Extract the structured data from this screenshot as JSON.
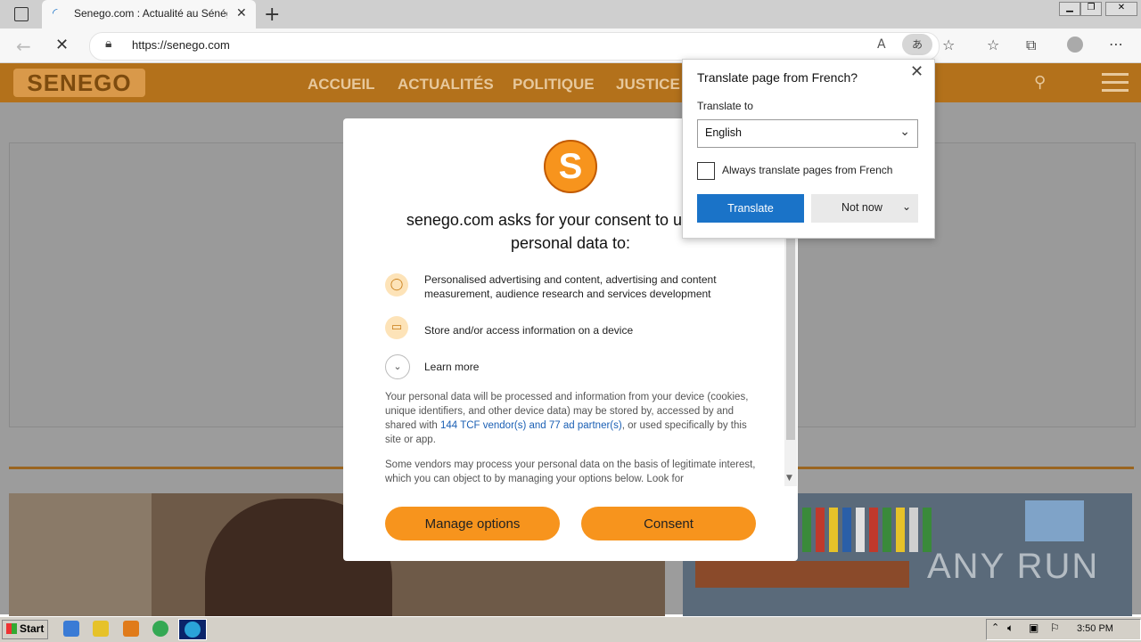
{
  "browser": {
    "tab_title": "Senego.com : Actualité au Sénégal",
    "url": "https://senego.com",
    "new_tab_label": "+"
  },
  "site": {
    "logo_text": "SENEGO",
    "nav": [
      "ACCUEIL",
      "ACTUALITÉS",
      "POLITIQUE",
      "JUSTICE"
    ]
  },
  "consent": {
    "logo_letter": "S",
    "title": "senego.com asks for your consent to use your personal data to:",
    "purposes": [
      {
        "icon": "person-icon",
        "text": "Personalised advertising and content, advertising and content measurement, audience research and services development"
      },
      {
        "icon": "device-icon",
        "text": "Store and/or access information on a device"
      }
    ],
    "learn_more": "Learn more",
    "para1_a": "Your personal data will be processed and information from your device (cookies, unique identifiers, and other device data) may be stored by, accessed by and shared with ",
    "para1_link": "144 TCF vendor(s) and 77 ad partner(s)",
    "para1_b": ", or used specifically by this site or app.",
    "para2": "Some vendors may process your personal data on the basis of legitimate interest, which you can object to by managing your options below. Look for",
    "manage_label": "Manage options",
    "consent_label": "Consent"
  },
  "translate": {
    "title": "Translate page from French?",
    "translate_to_label": "Translate to",
    "language": "English",
    "always_label": "Always translate pages from French",
    "translate_btn": "Translate",
    "not_now_btn": "Not now"
  },
  "taskbar": {
    "start": "Start",
    "clock": "3:50 PM"
  },
  "watermark": "ANY RUN"
}
